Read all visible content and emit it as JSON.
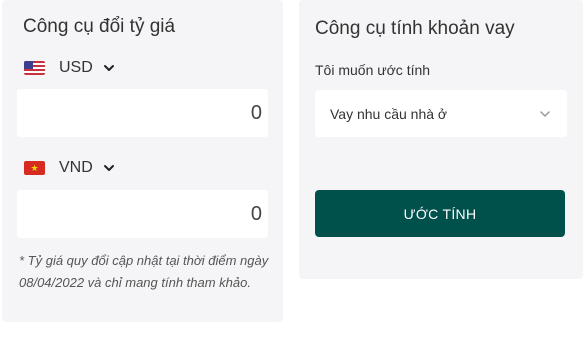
{
  "currency_tool": {
    "title": "Công cụ đổi tỷ giá",
    "from": {
      "code": "USD",
      "flag_icon": "us-flag-icon",
      "amount": "0"
    },
    "to": {
      "code": "VND",
      "flag_icon": "vn-flag-icon",
      "amount": "0"
    },
    "note": "* Tỷ giá quy đổi cập nhật tại thời điểm ngày 08/04/2022 và chỉ mang tính tham khảo."
  },
  "loan_tool": {
    "title": "Công cụ tính khoản vay",
    "estimate_label": "Tôi muốn ước tính",
    "selected_option": "Vay nhu cầu nhà ở",
    "calculate_label": "ƯỚC TÍNH"
  },
  "colors": {
    "panel_bg": "#f5f5f7",
    "button_bg": "#00504c",
    "button_text": "#ffffff"
  }
}
